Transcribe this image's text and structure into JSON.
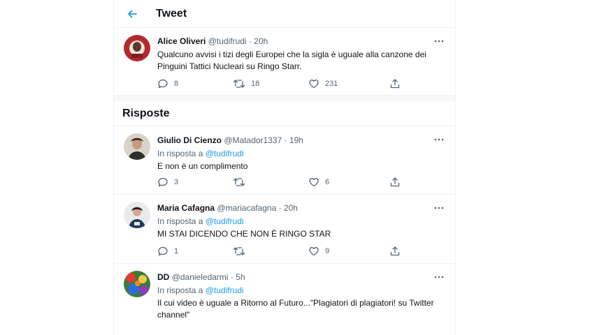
{
  "header": {
    "title": "Tweet"
  },
  "main_tweet": {
    "author": "Alice Oliveri",
    "handle": "@tudifrudi",
    "dot": "·",
    "time": "20h",
    "text": "Qualcuno avvisi i tizi degli Europei che la sigla è uguale alla canzone dei Pinguini Tattici Nucleari su Ringo Starr.",
    "replies": "8",
    "retweets": "18",
    "likes": "231"
  },
  "replies_section": {
    "title": "Risposte"
  },
  "replies": [
    {
      "author": "Giulio Di Cienzo",
      "handle": "@Matador1337",
      "dot": "·",
      "time": "19h",
      "reply_prefix": "In risposta a",
      "reply_to": "@tudifrudi",
      "text": "E non è un complimento",
      "replies": "3",
      "retweets": "",
      "likes": "6"
    },
    {
      "author": "Maria Cafagna",
      "handle": "@mariacafagna",
      "dot": "·",
      "time": "20h",
      "reply_prefix": "In risposta a",
      "reply_to": "@tudifrudi",
      "text": "MI STAI DICENDO CHE NON È RINGO STAR",
      "replies": "1",
      "retweets": "",
      "likes": "9"
    },
    {
      "author": "DD",
      "handle": "@danieledarmi",
      "dot": "·",
      "time": "5h",
      "reply_prefix": "In risposta a",
      "reply_to": "@tudifrudi",
      "text": "Il cui video è uguale a Ritorno al Futuro...\"Plagiatori di plagiatori! su Twitter channel\"",
      "replies": "",
      "retweets": "",
      "likes": ""
    }
  ],
  "colors": {
    "accent": "#1d9bf0",
    "secondary_text": "#536471",
    "divider": "#eff3f4"
  },
  "icons": [
    "back-arrow-icon",
    "more-icon",
    "reply-icon",
    "retweet-icon",
    "like-icon",
    "share-icon"
  ]
}
